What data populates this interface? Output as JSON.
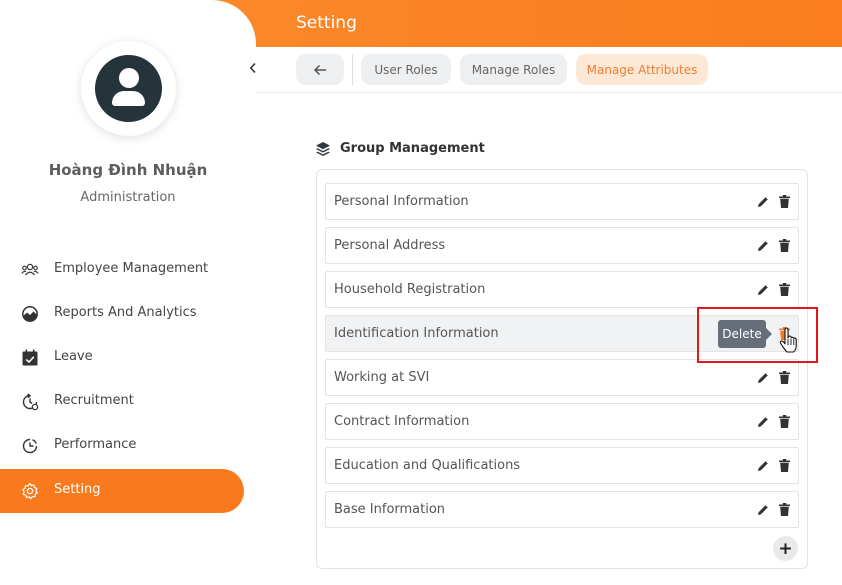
{
  "header": {
    "title": "Setting"
  },
  "sidebar": {
    "user_name": "Hoàng Đình Nhuận",
    "user_role": "Administration",
    "collapse_icon": "chevron-left-icon",
    "items": [
      {
        "label": "Employee Management",
        "icon": "users-icon",
        "active": false
      },
      {
        "label": "Reports And Analytics",
        "icon": "chart-icon",
        "active": false
      },
      {
        "label": "Leave",
        "icon": "calendar-check-icon",
        "active": false
      },
      {
        "label": "Recruitment",
        "icon": "recruitment-icon",
        "active": false
      },
      {
        "label": "Performance",
        "icon": "performance-icon",
        "active": false
      },
      {
        "label": "Setting",
        "icon": "gear-icon",
        "active": true
      }
    ]
  },
  "tabs": {
    "back_icon": "arrow-left-icon",
    "items": [
      {
        "label": "User Roles",
        "active": false
      },
      {
        "label": "Manage Roles",
        "active": false
      },
      {
        "label": "Manage Attributes",
        "active": true
      }
    ]
  },
  "group": {
    "title": "Group Management",
    "icon": "layers-icon",
    "rows": [
      {
        "label": "Personal Information"
      },
      {
        "label": "Personal Address"
      },
      {
        "label": "Household Registration"
      },
      {
        "label": "Identification Information"
      },
      {
        "label": "Working at SVI"
      },
      {
        "label": "Contract Information"
      },
      {
        "label": "Education and Qualifications"
      },
      {
        "label": "Base Information"
      }
    ],
    "add_label": "+"
  },
  "tooltip": {
    "text": "Delete"
  },
  "colors": {
    "accent": "#f9791d",
    "header": "#fb7d1c",
    "tab_active_bg": "#fde8d6",
    "tab_active_text": "#ed7f33",
    "highlight": "#e0181e"
  }
}
